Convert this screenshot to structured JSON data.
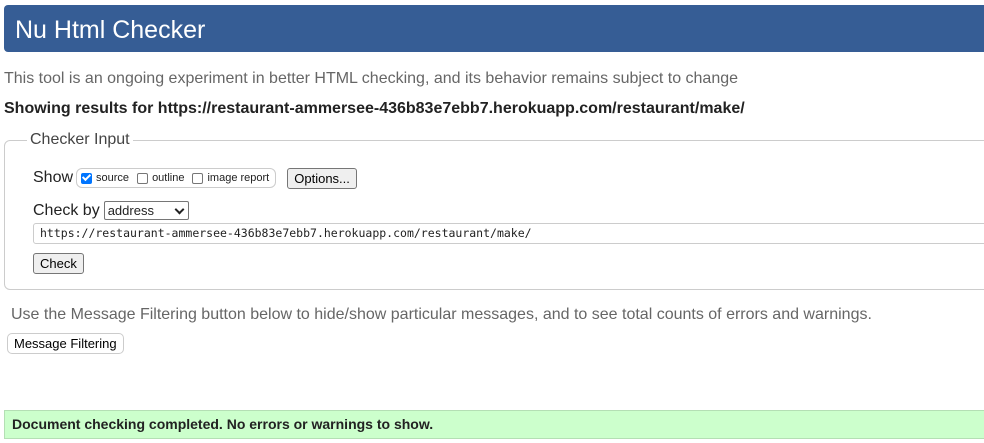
{
  "header": {
    "title": "Nu Html Checker"
  },
  "intro": {
    "tagline": "This tool is an ongoing experiment in better HTML checking, and its behavior remains subject to change",
    "results_for": "Showing results for https://restaurant-ammersee-436b83e7ebb7.herokuapp.com/restaurant/make/"
  },
  "checker_input": {
    "legend": "Checker Input",
    "show_label": "Show",
    "show_options": [
      {
        "label": "source",
        "checked": true
      },
      {
        "label": "outline",
        "checked": false
      },
      {
        "label": "image report",
        "checked": false
      }
    ],
    "options_button": "Options...",
    "check_by_label": "Check by",
    "check_by_value": "address",
    "url_value": "https://restaurant-ammersee-436b83e7ebb7.herokuapp.com/restaurant/make/",
    "check_button": "Check"
  },
  "filtering": {
    "note": "Use the Message Filtering button below to hide/show particular messages, and to see total counts of errors and warnings.",
    "button": "Message Filtering"
  },
  "result": {
    "message": "Document checking completed. No errors or warnings to show."
  },
  "colors": {
    "header_bg": "#365d95",
    "success_bg": "#ccffcc",
    "checkbox_accent": "#0075ff"
  }
}
